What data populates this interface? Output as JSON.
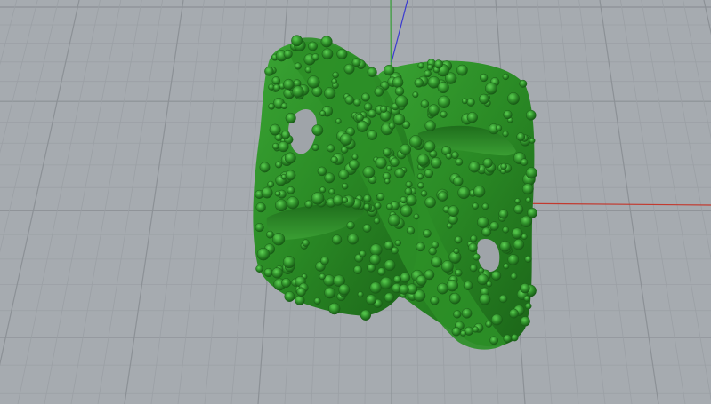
{
  "viewport": {
    "view": "perspective",
    "background_color": "#a6abb0",
    "grid_minor_color": "#9ba0a5",
    "grid_major_color": "#8c9196",
    "axis_x_color": "#c23a2f",
    "axis_y_color": "#3ca63c",
    "axis_z_color": "#3a3ad0"
  },
  "model": {
    "shape": "twisted-ring-pendant",
    "surface": "gem-studded",
    "color": "#2f8f2a",
    "color_dark": "#1e6b1c",
    "color_light": "#4fbf46"
  }
}
